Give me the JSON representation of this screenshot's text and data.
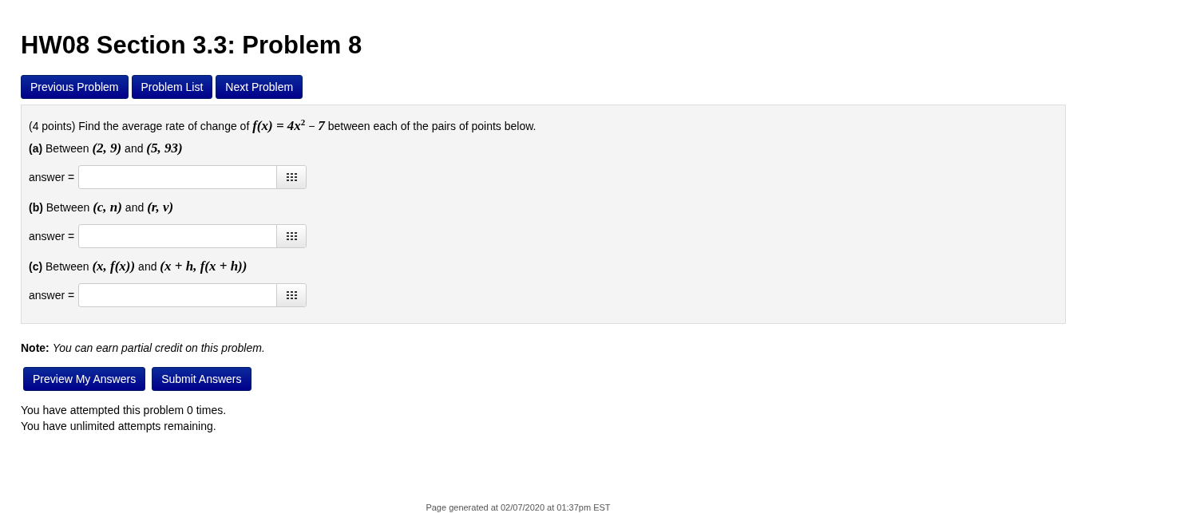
{
  "title": "HW08 Section 3.3: Problem 8",
  "nav_buttons": [
    "Previous Problem",
    "Problem List",
    "Next Problem"
  ],
  "problem": {
    "prompt": "(4 points) Find the average rate of change of *f(x) = 4x*$^{2}$ − *7* between each of the pairs of points below.",
    "parts": [
      {
        "question": "**(a)** Between *(2, 9)* and *(5, 93)*",
        "answer_label": "answer ="
      },
      {
        "question": "**(b)** Between *(c, n)* and *(r, v)*",
        "answer_label": "answer ="
      },
      {
        "question": "**(c)** Between *(x,  f(x))* and *(x + h,  f(x + h))*",
        "answer_label": "answer ="
      }
    ]
  },
  "note": "**Note:** *You can earn partial credit on this problem.*",
  "action_buttons": [
    "Preview My Answers",
    "Submit Answers"
  ],
  "attempts": [
    "You have attempted this problem 0 times.",
    "You have unlimited attempts remaining."
  ],
  "footer": "Page generated at 02/07/2020 at 01:37pm EST"
}
